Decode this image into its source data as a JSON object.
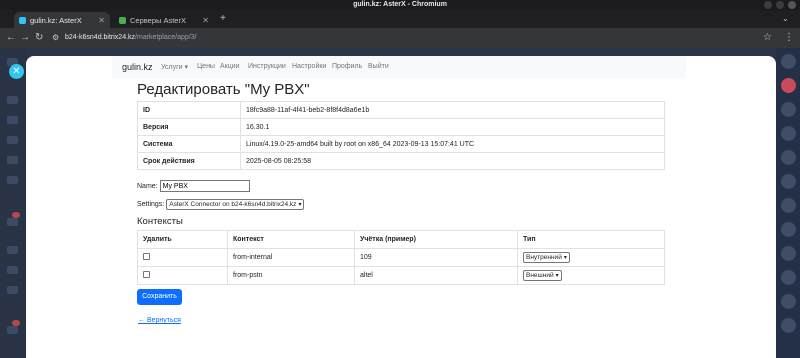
{
  "window": {
    "title": "gulin.kz: AsterX - Chromium"
  },
  "tabs": [
    {
      "label": "gulin.kz: AsterX",
      "active": true,
      "favicon_color": "#2fc6f6"
    },
    {
      "label": "Серверы AsterX",
      "active": false,
      "favicon_color": "#4caf50"
    }
  ],
  "address": {
    "host": "b24-k6sn4d.bitrix24.kz",
    "path": "/marketplace/app/3/"
  },
  "navbar": {
    "brand": "gulin.kz",
    "items": [
      "Услуги",
      "Цены",
      "Акции",
      "Инструкции",
      "Настройки",
      "Профиль",
      "Выйти"
    ]
  },
  "page": {
    "title": "Редактировать \"My PBX\"",
    "info": [
      {
        "key": "ID",
        "value": "18fc9a88-11af-4f41-beb2-8f8f4d8a6e1b"
      },
      {
        "key": "Версия",
        "value": "16.30.1"
      },
      {
        "key": "Система",
        "value": "Linux/4.19.0-25-amd64 built by root on x86_64 2023-09-13 15:07:41 UTC"
      },
      {
        "key": "Срок действия",
        "value": "2025-08-05 08:25:58"
      }
    ],
    "name_label": "Name:",
    "name_value": "My PBX",
    "settings_label": "Settings:",
    "settings_value": "AsterX Connector on b24-k6sn4d.bitrix24.kz",
    "contexts_title": "Контексты",
    "contexts_headers": [
      "Удалить",
      "Контекст",
      "Учётка (пример)",
      "Тип"
    ],
    "contexts": [
      {
        "context": "from-internal",
        "account": "109",
        "type": "Внутренний"
      },
      {
        "context": "from-pstn",
        "account": "altel",
        "type": "Внешний"
      }
    ],
    "save_label": "Сохранить",
    "back_label": "← Вернуться"
  }
}
